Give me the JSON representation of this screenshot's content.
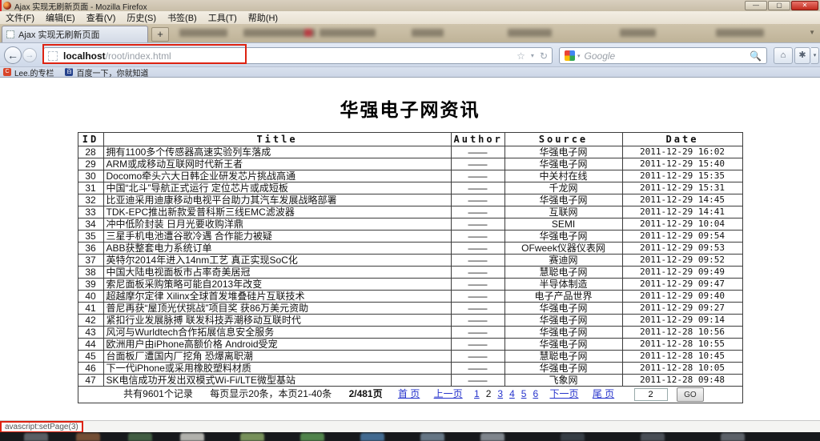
{
  "window": {
    "title": "Ajax 实现无刷新页面 - Mozilla Firefox",
    "minimize": "—",
    "maximize": "▢",
    "close": "✕",
    "menus": [
      "文件(F)",
      "编辑(E)",
      "查看(V)",
      "历史(S)",
      "书签(B)",
      "工具(T)",
      "帮助(H)"
    ],
    "tab_label": "Ajax 实现无刷新页面",
    "new_tab_label": "+",
    "back_glyph": "←",
    "forward_glyph": "→",
    "url_host": "localhost",
    "url_path": "/root/index.html",
    "star_glyph": "☆",
    "url_caret": "▾",
    "reload_glyph": "↻",
    "search_engine_label": "Google",
    "search_caret": "▾",
    "search_glyph": "🔍",
    "home_glyph": "⌂",
    "addon_glyph": "✱",
    "chrome_caret": "▾",
    "bookmarks": [
      {
        "icon": "C",
        "label": "Lee.的专栏"
      },
      {
        "icon": "百",
        "label": "百度一下，你就知道"
      }
    ]
  },
  "page": {
    "title": "华强电子网资讯",
    "table": {
      "headers": [
        "ID",
        "Title",
        "Author",
        "Source",
        "Date"
      ],
      "rows": [
        [
          "28",
          "拥有1100多个传感器高速实验列车落成",
          "——",
          "华强电子网",
          "2011-12-29 16:02"
        ],
        [
          "29",
          "ARM或成移动互联网时代新王者",
          "——",
          "华强电子网",
          "2011-12-29 15:40"
        ],
        [
          "30",
          "Docomo牵头六大日韩企业研发芯片挑战高通",
          "——",
          "中关村在线",
          "2011-12-29 15:35"
        ],
        [
          "31",
          "中国“北斗”导航正式运行 定位芯片或成短板",
          "——",
          "千龙网",
          "2011-12-29 15:31"
        ],
        [
          "32",
          "比亚迪采用迪康移动电视平台助力其汽车发展战略部署",
          "——",
          "华强电子网",
          "2011-12-29 14:45"
        ],
        [
          "33",
          "TDK-EPC推出新款爱普科斯三线EMC滤波器",
          "——",
          "互联网",
          "2011-12-29 14:41"
        ],
        [
          "34",
          "冲中低阶封装 日月光要收购洋鼎",
          "——",
          "SEMI",
          "2011-12-29 10:04"
        ],
        [
          "35",
          "三星手机电池遭谷歌冷遇 合作能力被疑",
          "——",
          "华强电子网",
          "2011-12-29 09:54"
        ],
        [
          "36",
          "ABB获整套电力系统订单",
          "——",
          "OFweek仪器仪表网",
          "2011-12-29 09:53"
        ],
        [
          "37",
          "英特尔2014年进入14nm工艺 真正实现SoC化",
          "——",
          "赛迪网",
          "2011-12-29 09:52"
        ],
        [
          "38",
          "中国大陆电视面板市占率奇美居冠",
          "——",
          "慧聪电子网",
          "2011-12-29 09:49"
        ],
        [
          "39",
          "索尼面板采购策略可能自2013年改变",
          "——",
          "半导体制造",
          "2011-12-29 09:47"
        ],
        [
          "40",
          "超越摩尔定律 Xilinx全球首发堆叠硅片互联技术",
          "——",
          "电子产品世界",
          "2011-12-29 09:40"
        ],
        [
          "41",
          "普尼再获“屋顶光伏挑战”项目奖 获86万美元资助",
          "——",
          "华强电子网",
          "2011-12-29 09:27"
        ],
        [
          "42",
          "紧扣行业发展脉搏 联发科技弄潮移动互联时代",
          "——",
          "华强电子网",
          "2011-12-29 09:14"
        ],
        [
          "43",
          "风河与Wurldtech合作拓展信息安全服务",
          "——",
          "华强电子网",
          "2011-12-28 10:56"
        ],
        [
          "44",
          "欧洲用户由iPhone高额价格 Android受宠",
          "——",
          "华强电子网",
          "2011-12-28 10:55"
        ],
        [
          "45",
          "台面板厂遭国内厂挖角 恐爆离职潮",
          "——",
          "慧聪电子网",
          "2011-12-28 10:45"
        ],
        [
          "46",
          "下一代iPhone或采用橡胶塑料材质",
          "——",
          "华强电子网",
          "2011-12-28 10:05"
        ],
        [
          "47",
          "SK电信成功开发出双模式Wi-Fi/LTE微型基站",
          "——",
          "飞象网",
          "2011-12-28 09:48"
        ]
      ]
    },
    "pagination": {
      "total_text": "共有9601个记录",
      "per_page_text": "每页显示20条，本页21-40条",
      "page_info": "2/481页",
      "first_label": "首 页",
      "prev_label": "上一页",
      "pages": [
        "1",
        "2",
        "3",
        "4",
        "5",
        "6"
      ],
      "current_page": "2",
      "next_label": "下一页",
      "last_label": "尾 页",
      "goto_value": "2",
      "go_label": "GO"
    }
  },
  "status_bar": {
    "text": "avascript:setPage(3)"
  },
  "colors": {
    "annotation_red": "#dd2211",
    "link_blue": "#2633cc",
    "chrome_tan": "#cfc4ac",
    "navbar_blue": "#dce5f2"
  }
}
